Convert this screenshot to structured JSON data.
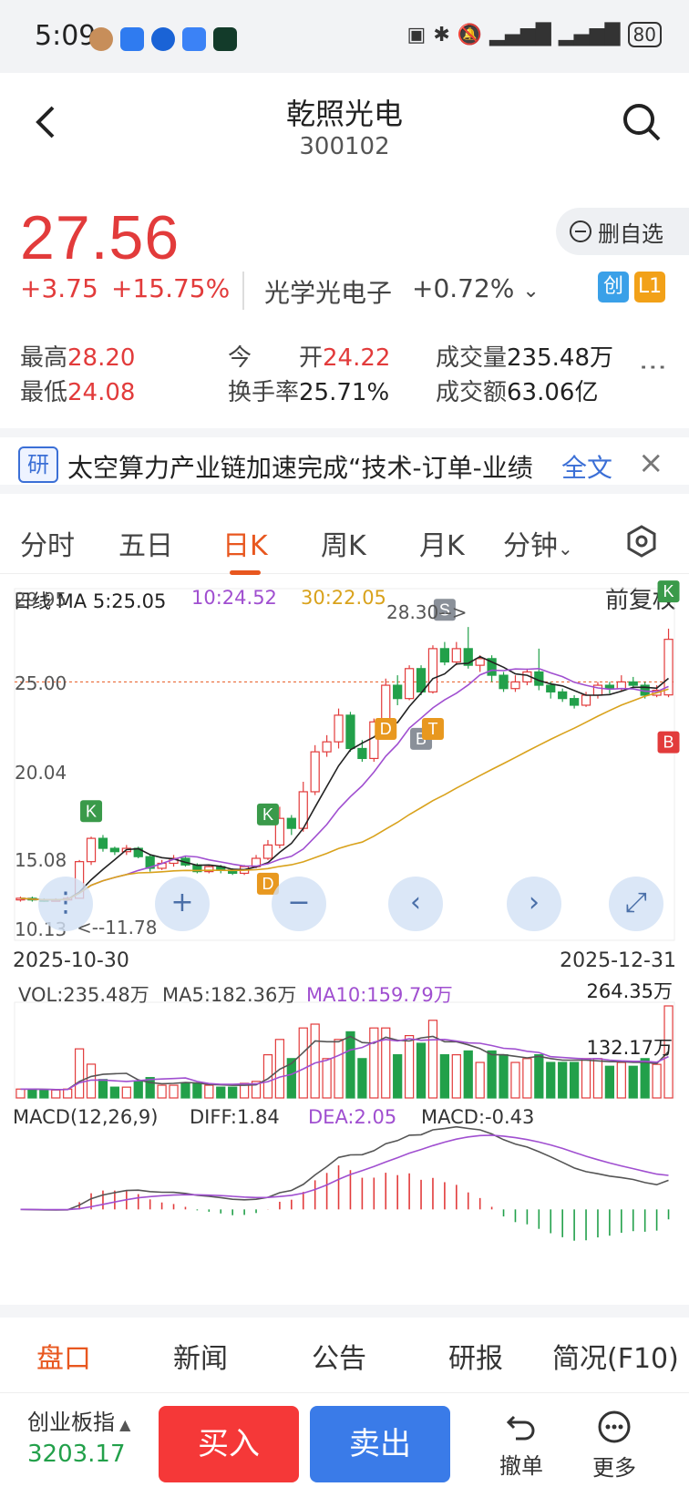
{
  "status_bar": {
    "time": "5:09",
    "battery": "80"
  },
  "header": {
    "stock_name": "乾照光电",
    "stock_code": "300102"
  },
  "quote": {
    "price": "27.56",
    "change_abs": "+3.75",
    "change_pct": "+15.75%",
    "sector_name": "光学光电子",
    "sector_change": "+0.72%",
    "unwatch_label": "删自选",
    "badge_chuang": "创",
    "badge_l1": "L1"
  },
  "stats": {
    "high_label": "最高",
    "high_value": "28.20",
    "low_label": "最低",
    "low_value": "24.08",
    "open_label": "今　　开",
    "open_value": "24.22",
    "turnover_label": "换手率",
    "turnover_value": "25.71%",
    "volume_label": "成交量",
    "volume_value": "235.48万",
    "amount_label": "成交额",
    "amount_value": "63.06亿"
  },
  "news": {
    "tag": "研",
    "text": "太空算力产业链加速完成“技术-订单-业绩",
    "full_label": "全文"
  },
  "tabs": [
    "分时",
    "五日",
    "日K",
    "周K",
    "月K",
    "分钟"
  ],
  "chart": {
    "ma_day_label": "日线 MA 5:25.05",
    "ma10_label": "10:24.52",
    "ma30_label": "30:22.05",
    "adjust_label": "前复权",
    "y_labels": [
      "29.95",
      "25.00",
      "20.04",
      "15.08",
      "10.13"
    ],
    "high_annotation": "28.30-->",
    "low_annotation": "<--11.78",
    "date_start": "2025-10-30",
    "date_end": "2025-12-31",
    "vol_label": "VOL:235.48万",
    "vol_ma5": "MA5:182.36万",
    "vol_ma10": "MA10:159.79万",
    "vol_max": "264.35万",
    "vol_mid": "132.17万",
    "macd_label": "MACD(12,26,9)",
    "diff_label": "DIFF:1.84",
    "dea_label": "DEA:2.05",
    "macd_value": "MACD:-0.43",
    "markers": {
      "k": "K",
      "d": "D",
      "s": "S",
      "b": "B",
      "t": "T"
    }
  },
  "chart_data": {
    "type": "candlestick",
    "title": "",
    "ylim": [
      10.13,
      29.95
    ],
    "x_range": [
      "2025-10-30",
      "2025-12-31"
    ],
    "candles": [
      [
        11.9,
        12.0,
        11.8,
        12.1
      ],
      [
        12.0,
        11.9,
        11.8,
        12.1
      ],
      [
        11.9,
        11.85,
        11.78,
        12.0
      ],
      [
        11.85,
        11.9,
        11.8,
        12.0
      ],
      [
        11.9,
        12.0,
        11.85,
        12.1
      ],
      [
        12.0,
        14.2,
        12.0,
        14.3
      ],
      [
        14.2,
        15.6,
        14.0,
        15.7
      ],
      [
        15.6,
        15.0,
        14.8,
        15.8
      ],
      [
        15.0,
        14.8,
        14.6,
        15.1
      ],
      [
        14.8,
        15.0,
        14.6,
        15.2
      ],
      [
        15.0,
        14.5,
        14.4,
        15.1
      ],
      [
        14.5,
        13.8,
        13.6,
        14.6
      ],
      [
        13.8,
        14.1,
        13.7,
        14.3
      ],
      [
        14.1,
        14.4,
        13.9,
        14.6
      ],
      [
        14.4,
        14.0,
        13.9,
        14.5
      ],
      [
        14.0,
        13.6,
        13.5,
        14.1
      ],
      [
        13.6,
        13.9,
        13.5,
        14.0
      ],
      [
        13.9,
        13.7,
        13.5,
        14.0
      ],
      [
        13.7,
        13.5,
        13.4,
        13.8
      ],
      [
        13.5,
        13.9,
        13.4,
        14.0
      ],
      [
        13.9,
        14.4,
        13.8,
        14.6
      ],
      [
        14.4,
        15.2,
        14.3,
        15.5
      ],
      [
        15.2,
        16.8,
        15.0,
        17.5
      ],
      [
        16.8,
        16.2,
        15.8,
        17.0
      ],
      [
        16.2,
        18.4,
        16.0,
        19.0
      ],
      [
        18.4,
        20.8,
        18.2,
        21.2
      ],
      [
        20.8,
        21.4,
        20.5,
        21.8
      ],
      [
        21.4,
        23.0,
        21.0,
        23.4
      ],
      [
        23.0,
        21.0,
        20.8,
        23.2
      ],
      [
        21.0,
        20.4,
        20.2,
        21.5
      ],
      [
        20.4,
        22.6,
        20.2,
        22.8
      ],
      [
        22.6,
        24.8,
        22.5,
        25.2
      ],
      [
        24.8,
        24.0,
        23.6,
        25.4
      ],
      [
        24.0,
        25.8,
        23.9,
        26.0
      ],
      [
        25.8,
        24.4,
        24.2,
        26.0
      ],
      [
        24.4,
        27.0,
        24.3,
        27.2
      ],
      [
        27.0,
        26.2,
        26.0,
        27.4
      ],
      [
        26.2,
        27.0,
        26.0,
        27.4
      ],
      [
        27.0,
        26.0,
        25.8,
        28.3
      ],
      [
        26.0,
        26.4,
        25.6,
        26.6
      ],
      [
        26.4,
        25.4,
        25.0,
        26.6
      ],
      [
        25.4,
        24.6,
        24.4,
        25.6
      ],
      [
        24.6,
        25.0,
        24.4,
        25.4
      ],
      [
        25.0,
        25.6,
        24.8,
        25.8
      ],
      [
        25.6,
        24.8,
        24.5,
        27.0
      ],
      [
        24.8,
        24.4,
        24.0,
        25.0
      ],
      [
        24.4,
        24.0,
        23.8,
        24.6
      ],
      [
        24.0,
        23.6,
        23.4,
        24.2
      ],
      [
        23.6,
        24.2,
        23.5,
        24.4
      ],
      [
        24.2,
        24.8,
        24.0,
        25.0
      ],
      [
        24.8,
        24.6,
        24.3,
        25.0
      ],
      [
        24.6,
        25.0,
        24.4,
        25.4
      ],
      [
        25.0,
        24.8,
        24.6,
        25.3
      ],
      [
        24.8,
        24.2,
        24.0,
        25.0
      ],
      [
        24.2,
        24.5,
        24.08,
        24.8
      ],
      [
        24.22,
        27.56,
        24.08,
        28.2
      ]
    ],
    "volume_ylim": [
      0,
      264.35
    ],
    "macd_ylim": [
      -1.5,
      3.0
    ]
  },
  "bottom_tabs": [
    "盘口",
    "新闻",
    "公告",
    "研报",
    "简况(F10)"
  ],
  "footer": {
    "index_name": "创业板指",
    "index_value": "3203.17",
    "buy_label": "买入",
    "sell_label": "卖出",
    "undo_label": "撤单",
    "more_label": "更多"
  },
  "colors": {
    "up": "#e23b3b",
    "down": "#22a04a",
    "ma5": "#222222",
    "ma10": "#a04fd0",
    "ma30": "#d9a21c",
    "accent": "#e8571f",
    "buy": "#f53838",
    "sell": "#3a7be8"
  }
}
